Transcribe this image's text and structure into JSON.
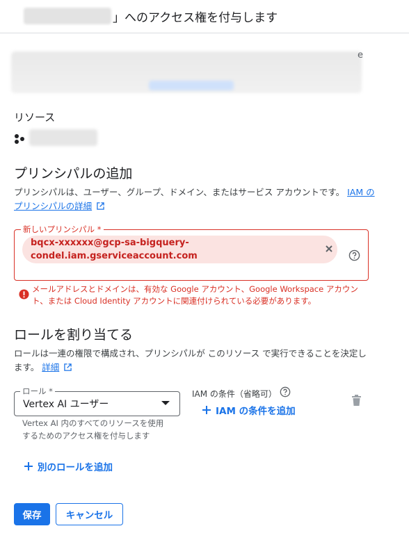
{
  "header": {
    "title_suffix": "」へのアクセス権を付与します"
  },
  "description": {
    "trailing_char": "e"
  },
  "resource": {
    "heading": "リソース"
  },
  "principals": {
    "heading": "プリンシパルの追加",
    "description": "プリンシパルは、ユーザー、グループ、ドメイン、またはサービス アカウントです。",
    "details_link": "IAM のプリンシパルの詳細",
    "field_label": "新しいプリンシパル *",
    "chip_value": "bqcx-xxxxxx@gcp-sa-bigquery-condel.iam.gserviceaccount.com",
    "error": "メールアドレスとドメインは、有効な Google アカウント、Google Workspace アカウント、または Cloud Identity アカウントに関連付けられている必要があります。"
  },
  "roles": {
    "heading": "ロールを割り当てる",
    "description": "ロールは一連の権限で構成され、プリンシパルが このリソース で実行できることを決定します。",
    "details_link": "詳細",
    "role_label": "ロール *",
    "role_value": "Vertex AI ユーザー",
    "role_help": "Vertex AI 内のすべてのリソースを使用するためのアクセス権を付与します",
    "condition_label": "IAM の条件（省略可）",
    "add_condition": "IAM の条件を追加",
    "add_role": "別のロールを追加"
  },
  "footer": {
    "save": "保存",
    "cancel": "キャンセル"
  },
  "colors": {
    "primary": "#1a73e8",
    "error": "#d93025",
    "chip_bg": "#fbe3e1"
  }
}
